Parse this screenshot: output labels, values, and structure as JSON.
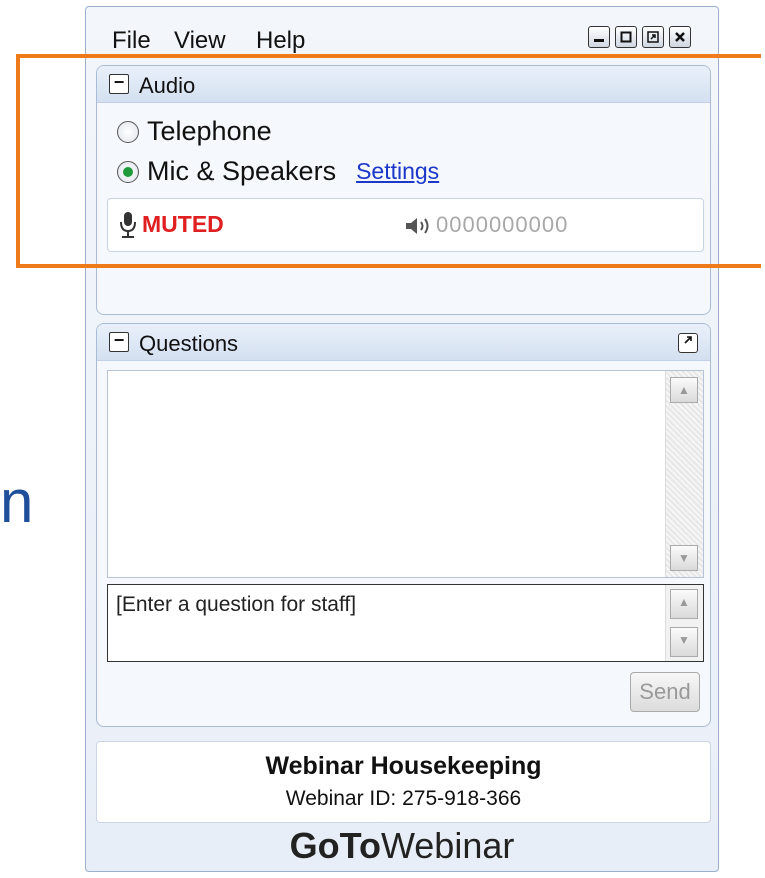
{
  "background_fragment": {
    "text": "n"
  },
  "menu": {
    "items": [
      {
        "label": "File"
      },
      {
        "label": "View"
      },
      {
        "label": "Help"
      }
    ]
  },
  "window_controls": [
    "minimize-icon",
    "maximize-icon",
    "restore-icon",
    "close-icon"
  ],
  "audio": {
    "title": "Audio",
    "options": [
      {
        "label": "Telephone",
        "checked": false
      },
      {
        "label": "Mic & Speakers",
        "checked": true
      }
    ],
    "settings_link": "Settings",
    "status": "MUTED",
    "level_meter": "0000000000"
  },
  "questions": {
    "title": "Questions",
    "input_placeholder": "[Enter a question for staff]",
    "send_label": "Send"
  },
  "footer": {
    "title": "Webinar Housekeeping",
    "webinar_id": "Webinar ID: 275-918-366",
    "brand_bold": "GoTo",
    "brand_regular": "Webinar"
  },
  "colors": {
    "accent_highlight": "#ef7a1a",
    "muted_red": "#e02020",
    "link_blue": "#1c37c9",
    "radio_green": "#1e9a3a"
  }
}
